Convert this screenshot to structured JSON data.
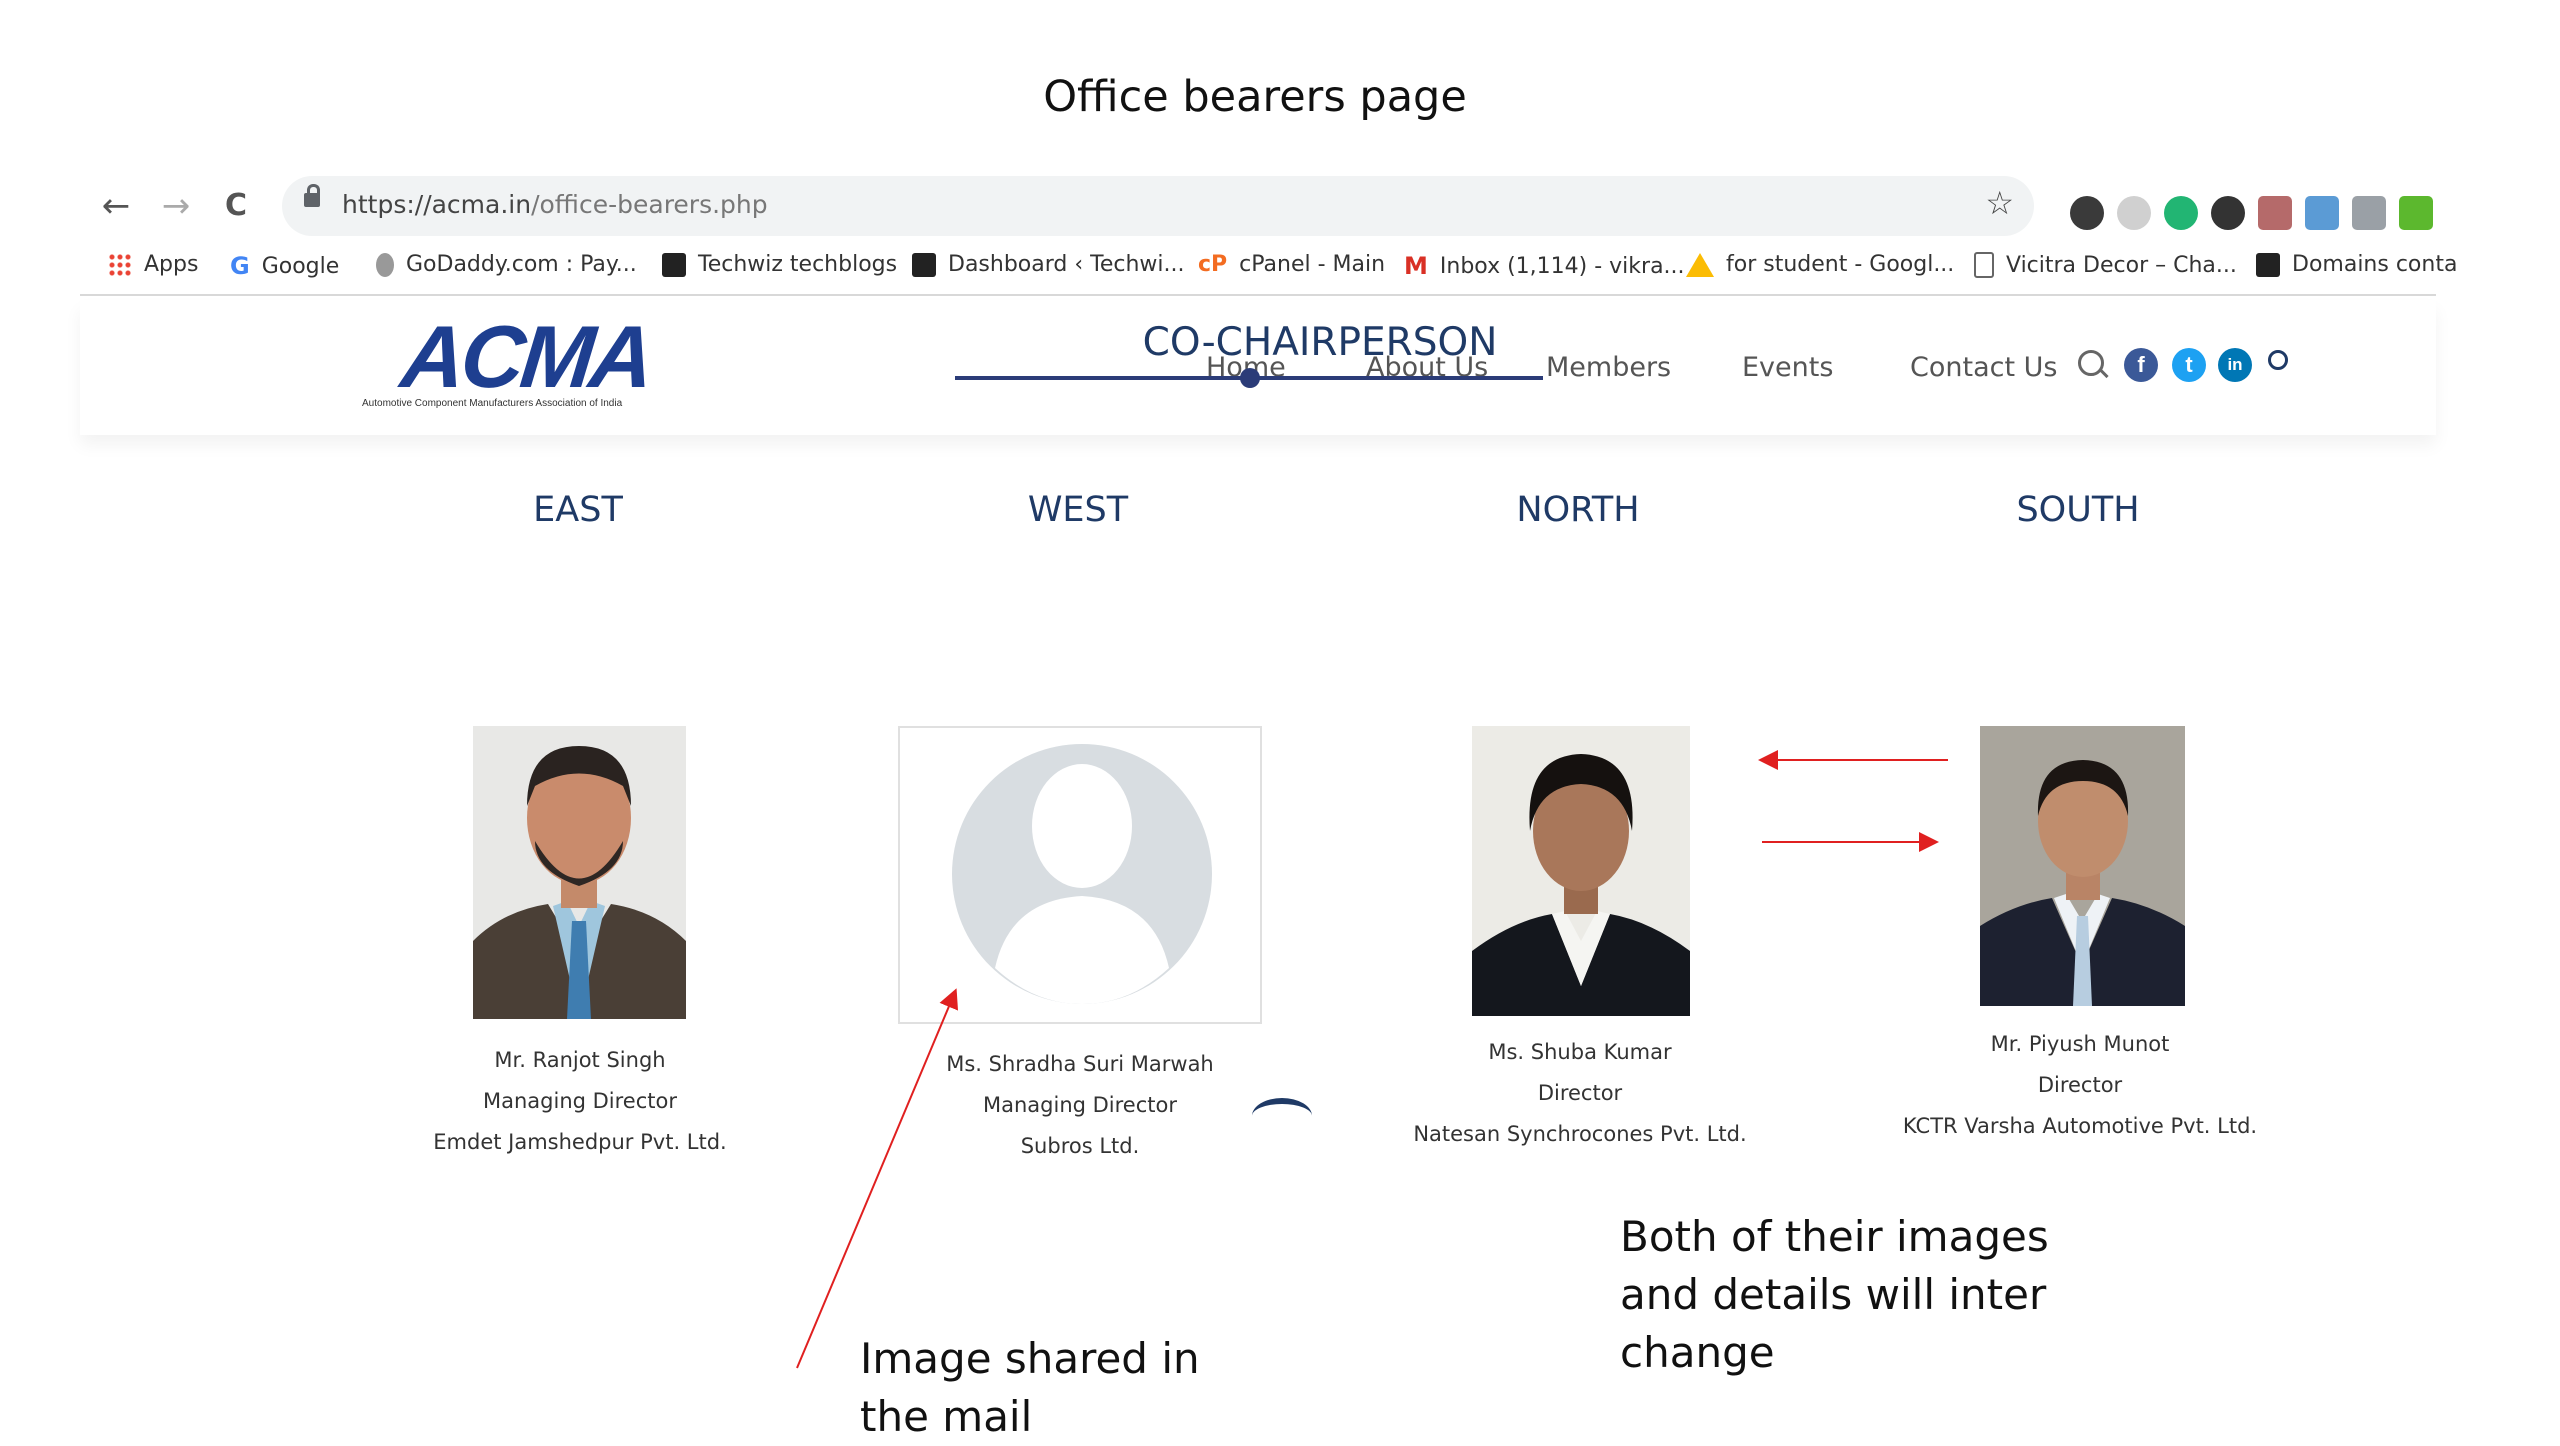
{
  "slide_title": "Office bearers page",
  "browser": {
    "url_host": "https://acma.in",
    "url_path": "/office-bearers.php",
    "nav": {
      "back": "←",
      "forward": "→",
      "reload": "C"
    },
    "star": "☆",
    "bookmarks": [
      {
        "label": "Apps",
        "icon": "apps-grid-icon",
        "color": "#4285f4"
      },
      {
        "label": "Google",
        "icon": "google-icon",
        "color": "#4285f4"
      },
      {
        "label": "GoDaddy.com : Pay...",
        "icon": "godaddy-icon",
        "color": "#888888"
      },
      {
        "label": "Techwiz techblogs",
        "icon": "techwiz-icon",
        "color": "#222222"
      },
      {
        "label": "Dashboard ‹ Techwi...",
        "icon": "dashboard-icon",
        "color": "#222222"
      },
      {
        "label": "cPanel - Main",
        "icon": "cpanel-icon",
        "color": "#f36c21"
      },
      {
        "label": "Inbox (1,114) - vikra...",
        "icon": "gmail-icon",
        "color": "#d93025"
      },
      {
        "label": "for student - Googl...",
        "icon": "drive-icon",
        "color": "#fbbc04"
      },
      {
        "label": "Vicitra Decor – Cha...",
        "icon": "page-icon",
        "color": "#ffffff"
      },
      {
        "label": "Domains conta",
        "icon": "lds-icon",
        "color": "#222222"
      }
    ],
    "extensions": [
      "#3a3a3a",
      "#d0d0d0",
      "#22b573",
      "#333333",
      "#b56a6a",
      "#5b9bd5",
      "#9aa0a6",
      "#5cb82e"
    ]
  },
  "site": {
    "logo_text": "ACMA",
    "logo_subtitle": "Automotive Component Manufacturers Association of India",
    "menu": [
      "Home",
      "About Us",
      "Members",
      "Events",
      "Contact Us"
    ],
    "social": [
      {
        "icon": "facebook-icon",
        "glyph": "f",
        "color": "#3b5998"
      },
      {
        "icon": "twitter-icon",
        "glyph": "t",
        "color": "#1da1f2"
      },
      {
        "icon": "linkedin-icon",
        "glyph": "in",
        "color": "#0077b5"
      }
    ]
  },
  "section": {
    "title": "CO-CHAIRPERSON",
    "members": [
      {
        "region": "EAST",
        "name": "Mr. Ranjot Singh",
        "designation": "Managing Director",
        "company": "Emdet Jamshedpur Pvt. Ltd."
      },
      {
        "region": "WEST",
        "name": "Ms. Shradha Suri Marwah",
        "designation": "Managing Director",
        "company": "Subros Ltd."
      },
      {
        "region": "NORTH",
        "name": "Ms. Shuba Kumar",
        "designation": "Director",
        "company": "Natesan Synchrocones Pvt. Ltd."
      },
      {
        "region": "SOUTH",
        "name": "Mr. Piyush Munot",
        "designation": "Director",
        "company": "KCTR Varsha Automotive Pvt. Ltd."
      }
    ]
  },
  "annotations": {
    "image_note": [
      "Image shared in",
      "the mail"
    ],
    "swap_note": [
      "Both of their images",
      "and details will inter",
      "change"
    ]
  },
  "colors": {
    "accent": "#1f3a66",
    "arrow": "#e02020",
    "logo": "#1e3f90"
  }
}
